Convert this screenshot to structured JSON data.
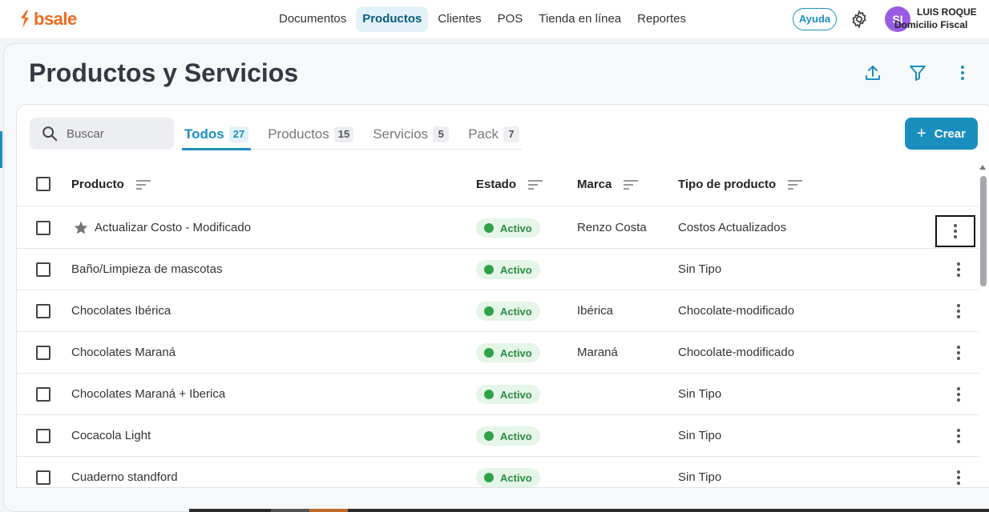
{
  "app": {
    "logo_text": "bsale",
    "brand_color": "#f26b1d",
    "accent_color": "#1a8fbf"
  },
  "nav": {
    "items": [
      {
        "label": "Documentos",
        "active": false
      },
      {
        "label": "Productos",
        "active": true
      },
      {
        "label": "Clientes",
        "active": false
      },
      {
        "label": "POS",
        "active": false
      },
      {
        "label": "Tienda en línea",
        "active": false
      },
      {
        "label": "Reportes",
        "active": false
      }
    ]
  },
  "header": {
    "help_label": "Ayuda",
    "settings_icon": "gear-icon",
    "avatar_initials": "SI",
    "user_name": "LUIS ROQUE",
    "user_subtitle": "Domicilio Fiscal"
  },
  "page": {
    "title": "Productos y Servicios",
    "actions": [
      "upload-icon",
      "filter-icon",
      "more-vertical-icon"
    ]
  },
  "toolbar": {
    "search_placeholder": "Buscar",
    "tabs": [
      {
        "label": "Todos",
        "count": "27",
        "active": true
      },
      {
        "label": "Productos",
        "count": "15",
        "active": false
      },
      {
        "label": "Servicios",
        "count": "5",
        "active": false
      },
      {
        "label": "Pack",
        "count": "7",
        "active": false
      }
    ],
    "create_icon": "+",
    "create_label": "Crear"
  },
  "table": {
    "columns": [
      "Producto",
      "Estado",
      "Marca",
      "Tipo de producto"
    ],
    "rows": [
      {
        "producto": "Actualizar Costo - Modificado",
        "starred": true,
        "estado": "Activo",
        "marca": "Renzo Costa",
        "tipo": "Costos Actualizados",
        "menu_focused": true
      },
      {
        "producto": "Baño/Limpieza de mascotas",
        "starred": false,
        "estado": "Activo",
        "marca": "",
        "tipo": "Sin Tipo",
        "menu_focused": false
      },
      {
        "producto": "Chocolates Ibérica",
        "starred": false,
        "estado": "Activo",
        "marca": "Ibérica",
        "tipo": "Chocolate-modificado",
        "menu_focused": false
      },
      {
        "producto": "Chocolates Maraná",
        "starred": false,
        "estado": "Activo",
        "marca": "Maraná",
        "tipo": "Chocolate-modificado",
        "menu_focused": false
      },
      {
        "producto": "Chocolates Maraná + Iberica",
        "starred": false,
        "estado": "Activo",
        "marca": "",
        "tipo": "Sin Tipo",
        "menu_focused": false
      },
      {
        "producto": "Cocacola Light",
        "starred": false,
        "estado": "Activo",
        "marca": "",
        "tipo": "Sin Tipo",
        "menu_focused": false
      },
      {
        "producto": "Cuaderno standford",
        "starred": false,
        "estado": "Activo",
        "marca": "",
        "tipo": "Sin Tipo",
        "menu_focused": false
      }
    ],
    "status_color": "#2fa34a"
  }
}
